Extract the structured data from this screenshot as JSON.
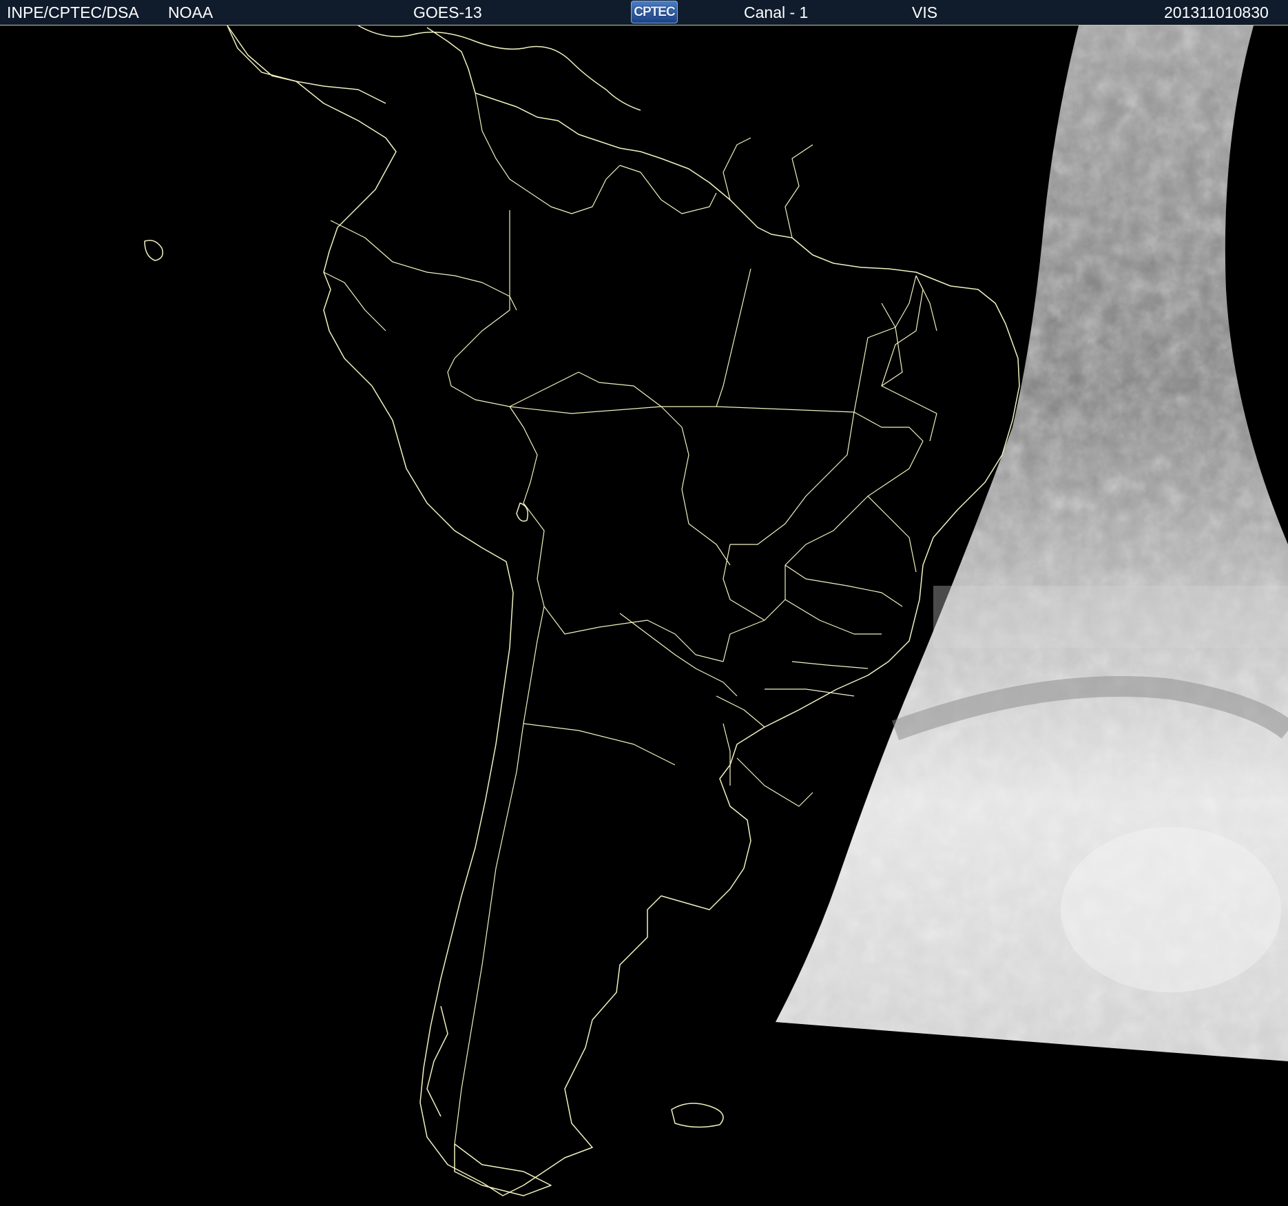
{
  "header": {
    "org": "INPE/CPTEC/DSA",
    "agency": "NOAA",
    "satellite": "GOES-13",
    "logo_text": "CPTEC",
    "channel": "Canal - 1",
    "band": "VIS",
    "timestamp": "201311010830"
  },
  "colors": {
    "header_bg": "#101c2c",
    "header_text": "#ffffff",
    "coastline": "#f2f2c0",
    "background": "#000000"
  }
}
